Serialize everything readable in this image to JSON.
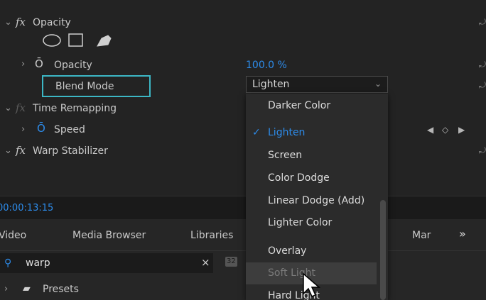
{
  "effects": {
    "opacity_group": "Opacity",
    "opacity_param": "Opacity",
    "opacity_value": "100.0 %",
    "blend_mode_label": "Blend Mode",
    "blend_mode_value": "Lighten",
    "time_remapping": "Time Remapping",
    "speed": "Speed",
    "warp_stabilizer": "Warp Stabilizer"
  },
  "timecode": "00:00:13:15",
  "tabs": {
    "video": "Video",
    "media_browser": "Media Browser",
    "libraries": "Libraries",
    "markers": "Mar",
    "overflow": "»"
  },
  "search": {
    "value": "warp"
  },
  "presets_label": "Presets",
  "blend_menu": {
    "items": [
      {
        "label": "Darker Color",
        "selected": false
      },
      {
        "label": "Lighten",
        "selected": true
      },
      {
        "label": "Screen",
        "selected": false
      },
      {
        "label": "Color Dodge",
        "selected": false
      },
      {
        "label": "Linear Dodge (Add)",
        "selected": false
      },
      {
        "label": "Lighter Color",
        "selected": false
      },
      {
        "label": "Overlay",
        "selected": false
      },
      {
        "label": "Soft Light",
        "selected": false,
        "hover": true
      },
      {
        "label": "Hard Light",
        "selected": false
      }
    ]
  },
  "colors": {
    "accent_blue": "#2d8ceb",
    "highlight_teal": "#3cb7c5"
  }
}
